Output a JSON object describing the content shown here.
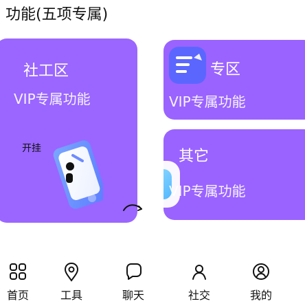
{
  "header": {
    "title": "功能(五项专属)"
  },
  "cards": {
    "social": {
      "title": "社工区",
      "subtitle": "VIP专属功能",
      "phone_label": "开挂"
    },
    "gym": {
      "title": "专区",
      "subtitle": "VIP专属功能"
    },
    "other": {
      "title": "其它",
      "subtitle": "VIP专属功能"
    }
  },
  "tabbar": {
    "items": [
      {
        "label": "首页",
        "icon": "grid-icon"
      },
      {
        "label": "工具",
        "icon": "location-icon"
      },
      {
        "label": "聊天",
        "icon": "chat-icon"
      },
      {
        "label": "社交",
        "icon": "people-icon"
      },
      {
        "label": "我的",
        "icon": "profile-icon"
      }
    ]
  },
  "colors": {
    "card": "#9A63FF",
    "card_alt": "#9A66FF",
    "text": "#111111"
  }
}
